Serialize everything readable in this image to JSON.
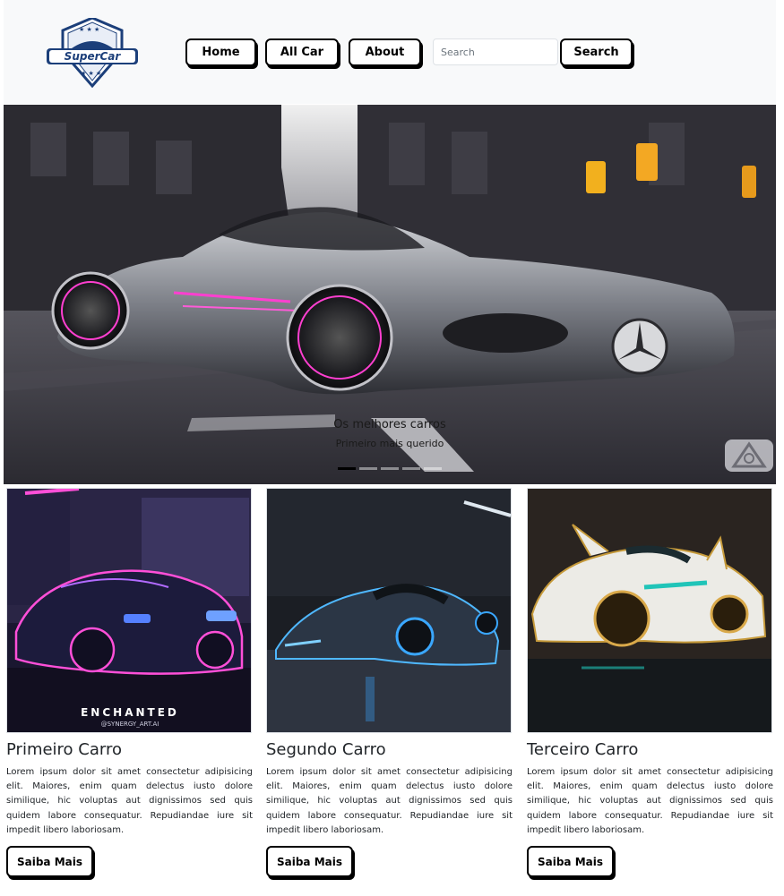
{
  "header": {
    "logo_text": "SuperCar",
    "nav": [
      "Home",
      "All Car",
      "About"
    ],
    "search_placeholder": "Search",
    "search_button": "Search"
  },
  "hero": {
    "caption_title": "Os melhores carros",
    "caption_subtitle": "Primeiro mais querido",
    "slide_count": 5,
    "active_slide": 1
  },
  "cards": [
    {
      "title": "Primeiro Carro",
      "text": "Lorem ipsum dolor sit amet consectetur adipisicing elit. Maiores, enim quam delectus iusto dolore similique, hic voluptas aut dignissimos sed quis quidem labore consequatur. Repudiandae iure sit impedit libero laboriosam.",
      "button": "Saiba Mais",
      "image_text": "ENCHANTED",
      "image_subtext": "@SYNERGY_ART.AI"
    },
    {
      "title": "Segundo Carro",
      "text": "Lorem ipsum dolor sit amet consectetur adipisicing elit. Maiores, enim quam delectus iusto dolore similique, hic voluptas aut dignissimos sed quis quidem labore consequatur. Repudiandae iure sit impedit libero laboriosam.",
      "button": "Saiba Mais"
    },
    {
      "title": "Terceiro Carro",
      "text": "Lorem ipsum dolor sit amet consectetur adipisicing elit. Maiores, enim quam delectus iusto dolore similique, hic voluptas aut dignissimos sed quis quidem labore consequatur. Repudiandae iure sit impedit libero laboriosam.",
      "button": "Saiba Mais"
    }
  ],
  "colors": {
    "header_bg": "#f8f9fa",
    "logo_blue": "#1c3f7a",
    "button_border": "#000000"
  }
}
